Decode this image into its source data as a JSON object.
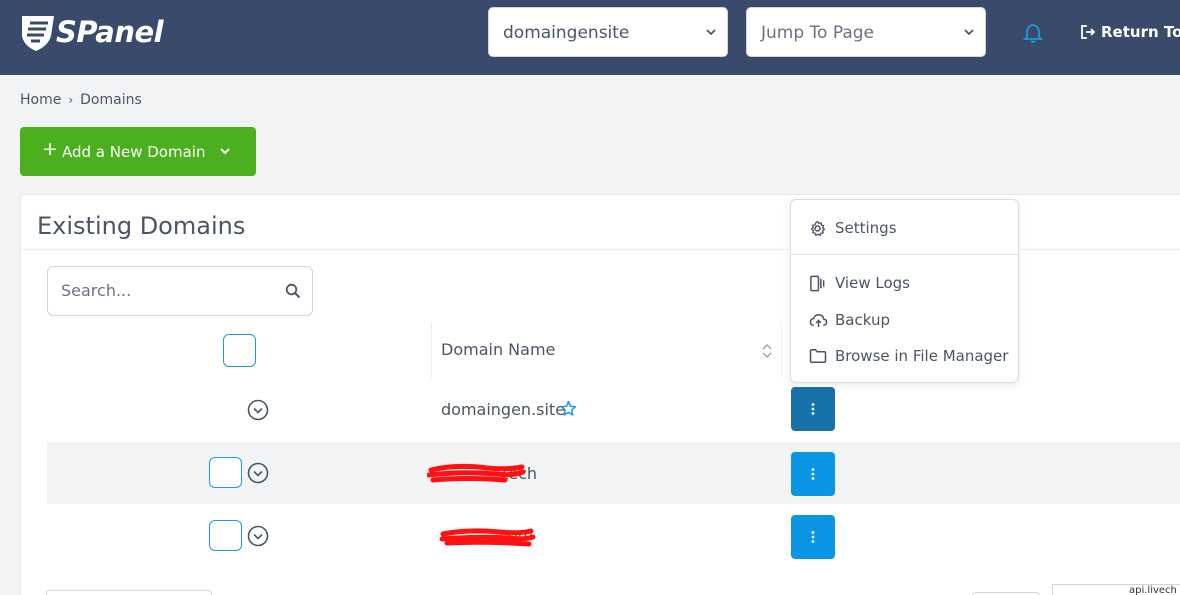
{
  "header": {
    "brand": "SPanel",
    "domain_select": {
      "value": "domaingensite"
    },
    "jump_select": {
      "value": "Jump To Page"
    },
    "return_label": "Return To A"
  },
  "breadcrumb": {
    "home": "Home",
    "current": "Domains"
  },
  "add_button": {
    "label": "Add a New Domain"
  },
  "card": {
    "title": "Existing Domains",
    "search_placeholder": "Search...",
    "column_title": "Domain Name"
  },
  "rows": [
    {
      "domain": "domaingen.site",
      "primary": true
    },
    {
      "domain": "tech",
      "primary": false
    },
    {
      "domain": ".com",
      "primary": false
    }
  ],
  "menu": {
    "items": [
      "Settings",
      "View Logs",
      "Backup",
      "Browse in File Manager"
    ]
  },
  "footer_fragment": "api.livech",
  "colors": {
    "header": "#394a6b",
    "accent": "#0b96e5",
    "success": "#4caf1e",
    "redact": "#ff0000"
  }
}
